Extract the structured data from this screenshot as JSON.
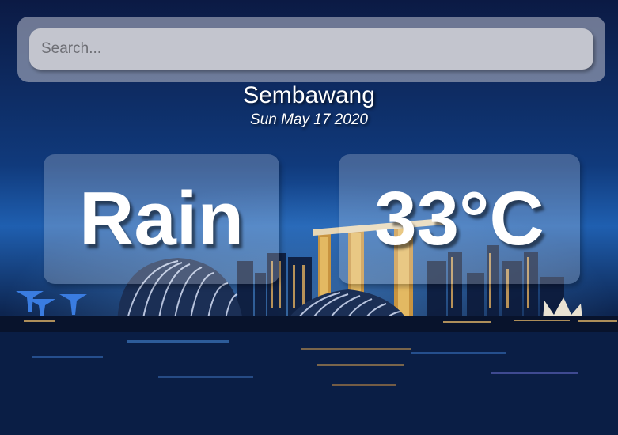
{
  "search": {
    "placeholder": "Search..."
  },
  "location": {
    "name": "Sembawang",
    "date": "Sun May 17 2020"
  },
  "weather": {
    "condition": "Rain",
    "temperature": "33°C"
  },
  "colors": {
    "panel": "#aab0c0",
    "input": "#c3c5ce",
    "text": "#ffffff"
  }
}
